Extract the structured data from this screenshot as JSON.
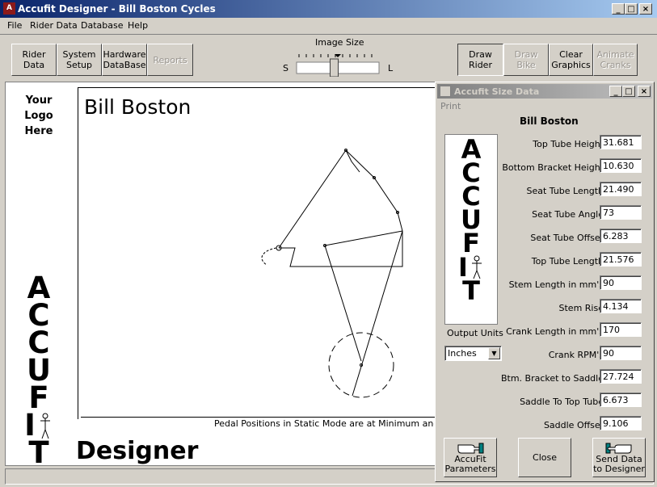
{
  "window": {
    "title": "Accufit Designer  - Bill Boston Cycles",
    "icon": "app-icon"
  },
  "menu": [
    "File",
    "Rider Data",
    "Database",
    "Help"
  ],
  "toolbar": {
    "left_buttons": [
      {
        "l1": "Rider",
        "l2": "Data",
        "enabled": true
      },
      {
        "l1": "System",
        "l2": "Setup",
        "enabled": true
      },
      {
        "l1": "Hardware",
        "l2": "DataBase",
        "enabled": true
      },
      {
        "l1": "Reports",
        "l2": "",
        "enabled": false
      }
    ],
    "image_size": {
      "label": "Image Size",
      "min_label": "S",
      "max_label": "L",
      "value": 0.45
    },
    "right_buttons": [
      {
        "l1": "Draw",
        "l2": "Rider",
        "enabled": true,
        "pressed": true
      },
      {
        "l1": "Draw Bike",
        "l2": "",
        "enabled": false
      },
      {
        "l1": "Clear",
        "l2": "Graphics",
        "enabled": true
      },
      {
        "l1": "Animate",
        "l2": "Cranks",
        "enabled": false
      }
    ]
  },
  "canvas": {
    "logo_placeholder": [
      "Your",
      "Logo",
      "Here"
    ],
    "rider_name": "Bill Boston",
    "brand_letters": [
      "A",
      "C",
      "C",
      "U",
      "F",
      "I",
      "T"
    ],
    "footer_note": "Pedal Positions in Static Mode are at Minimum and Maxim",
    "product_word": "Designer"
  },
  "dialog": {
    "title": "Accufit Size Data",
    "menu_print": "Print",
    "rider_name": "Bill Boston",
    "brand_letters": [
      "A",
      "C",
      "C",
      "U",
      "F",
      "I",
      "T"
    ],
    "output_units_label": "Output Units",
    "output_units_value": "Inches",
    "fields": [
      {
        "label": "Top Tube Height",
        "value": "31.681"
      },
      {
        "label": "Bottom Bracket Height",
        "value": "10.630"
      },
      {
        "label": "Seat Tube Length",
        "value": "21.490"
      },
      {
        "label": "Seat Tube Angle",
        "value": "73"
      },
      {
        "label": "Seat Tube Offset",
        "value": "6.283"
      },
      {
        "label": "Top Tube Length",
        "value": "21.576"
      },
      {
        "label": "Stem Length in mm's",
        "value": "90"
      },
      {
        "label": "Stem Rise",
        "value": "4.134"
      },
      {
        "label": "Crank Length in mm's",
        "value": "170"
      },
      {
        "label": "Crank RPM's",
        "value": "90"
      },
      {
        "label": "Btm. Bracket to Saddle",
        "value": "27.724"
      },
      {
        "label": "Saddle To Top Tube",
        "value": "6.673"
      },
      {
        "label": "Saddle Offset",
        "value": "9.106"
      }
    ],
    "buttons": {
      "params_l1": "AccuFit",
      "params_l2": "Parameters",
      "close": "Close",
      "send_l1": "Send Data",
      "send_l2": "to Designer"
    }
  },
  "window_controls": {
    "minimize": "_",
    "maximize": "□",
    "close": "×"
  },
  "colors": {
    "title_active": "#0a246a",
    "title_inactive": "#808080",
    "face": "#d4d0c8"
  }
}
